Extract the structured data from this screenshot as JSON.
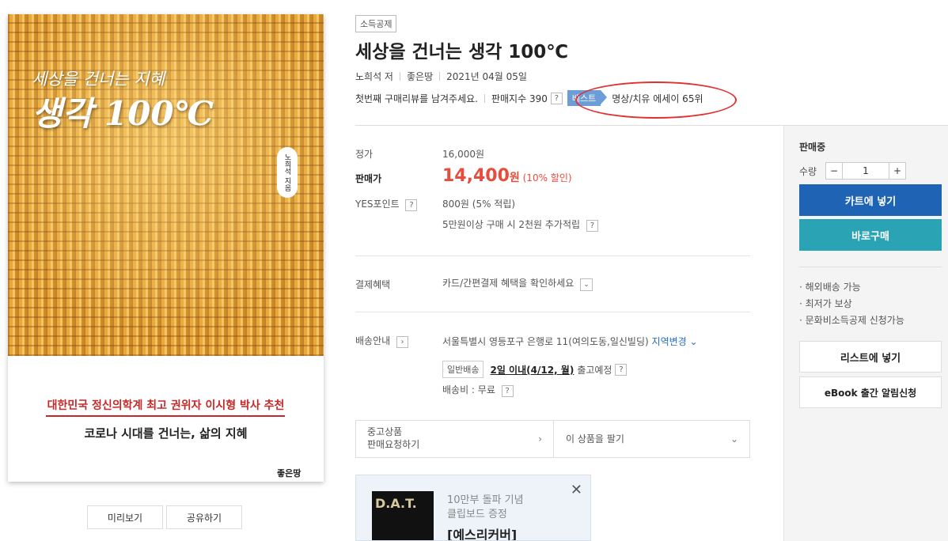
{
  "cover": {
    "subtitle": "세상을 건너는 지혜",
    "title": "생각 100℃",
    "author_vertical": "노희석 지음",
    "recommend": "대한민국 정신의학계 최고 권위자 이시형 박사 추천",
    "tagline": "코로나 시대를 건너는, 삶의 지혜",
    "publisher": "좋은땅",
    "buttons": {
      "preview": "미리보기",
      "share": "공유하기"
    }
  },
  "header": {
    "tax_badge": "소득공제",
    "title": "세상을 건너는 생각 100℃",
    "author": "노희석 저",
    "publisher": "좋은땅",
    "date": "2021년 04월 05일",
    "review_prompt": "첫번째 구매리뷰를 남겨주세요.",
    "sales_index": "판매지수 390",
    "help": "?",
    "best_badge": "베스트",
    "best_rank": "명상/치유 에세이 65위"
  },
  "price": {
    "list_label": "정가",
    "list_value": "16,000원",
    "sale_label": "판매가",
    "sale_amount": "14,400",
    "sale_won": "원",
    "sale_discount": "(10% 할인)",
    "points_label": "YES포인트",
    "points_value": "800원 (5% 적립)",
    "points_extra": "5만원이상 구매 시 2천원 추가적립"
  },
  "benefit": {
    "label": "결제혜택",
    "value": "카드/간편결제 혜택을 확인하세요"
  },
  "shipping": {
    "label": "배송안내",
    "address": "서울특별시 영등포구 은행로 11(여의도동,일신빌딩)",
    "region_change": "지역변경",
    "type_tag": "일반배송",
    "eta_strong": "2일 이내(4/12, 월)",
    "eta_rest": "출고예정",
    "fee": "배송비 : 무료"
  },
  "used": {
    "line1": "중고상품",
    "line2": "판매요청하기",
    "sell": "이 상품을 팔기"
  },
  "ad": {
    "line1": "10만부 돌파 기념",
    "line2": "클립보드 증정",
    "line3": "[예스리커버]",
    "img_text": "D.A.T."
  },
  "panel": {
    "status": "판매중",
    "qty_label": "수량",
    "qty_value": "1",
    "minus": "−",
    "plus": "+",
    "cart": "카트에 넣기",
    "buy": "바로구매",
    "bullets": [
      "· 해외배송 가능",
      "· 최저가 보상",
      "· 문화비소득공제 신청가능"
    ],
    "list": "리스트에 넣기",
    "ebook": "eBook 출간 알림신청"
  }
}
